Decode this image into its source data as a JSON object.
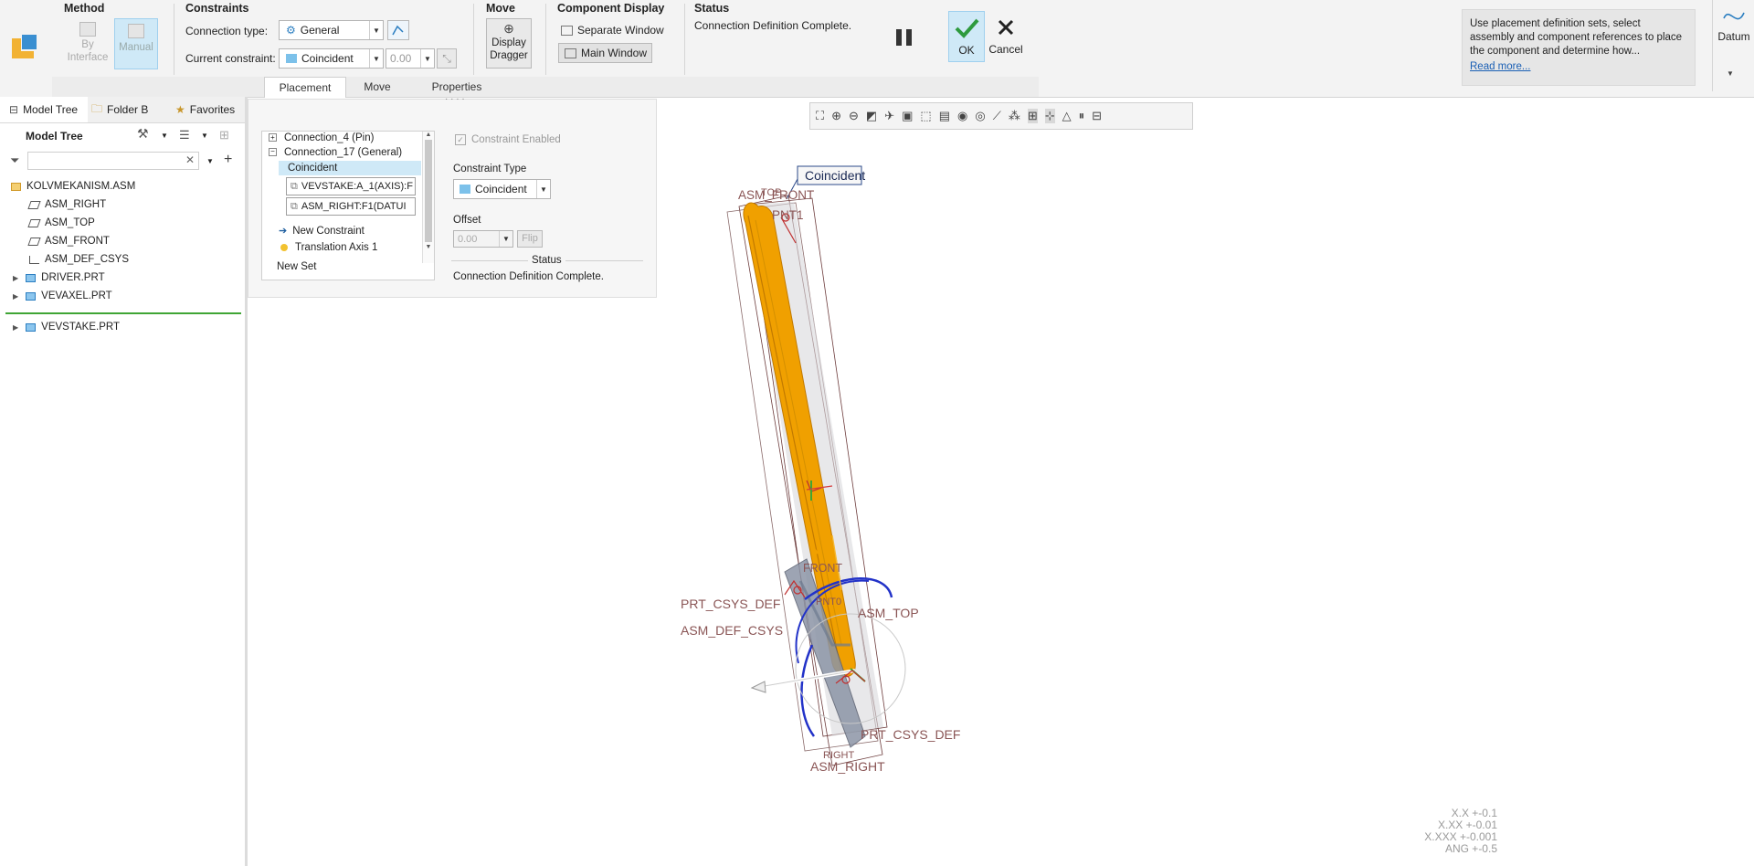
{
  "ribbon": {
    "method": {
      "title": "Method",
      "by_interface": "By\nInterface",
      "manual": "Manual"
    },
    "constraints": {
      "title": "Constraints",
      "connection_type_label": "Connection type:",
      "connection_type_value": "General",
      "current_constraint_label": "Current constraint:",
      "current_constraint_value": "Coincident",
      "offset_value": "0.00"
    },
    "move": {
      "title": "Move",
      "display_dragger": "Display\nDragger"
    },
    "component_display": {
      "title": "Component Display",
      "separate_window": "Separate Window",
      "main_window": "Main Window"
    },
    "status": {
      "title": "Status",
      "text": "Connection Definition Complete."
    },
    "ok_label": "OK",
    "cancel_label": "Cancel",
    "help_text": "Use placement definition sets, select assembly and component references to place the component and determine how...",
    "read_more": "Read more...",
    "datum_label": "Datum",
    "tabs": [
      "Placement",
      "Move",
      "Properties"
    ],
    "accent_color": "#cfe9f7"
  },
  "left_panel": {
    "tabs": [
      "Model Tree",
      "Folder B",
      "Favorites"
    ],
    "tree_title": "Model Tree",
    "filter_placeholder": "",
    "items": [
      {
        "label": "KOLVMEKANISM.ASM",
        "icon": "assembly-icon"
      },
      {
        "label": "ASM_RIGHT",
        "icon": "datum-plane-icon"
      },
      {
        "label": "ASM_TOP",
        "icon": "datum-plane-icon"
      },
      {
        "label": "ASM_FRONT",
        "icon": "datum-plane-icon"
      },
      {
        "label": "ASM_DEF_CSYS",
        "icon": "csys-icon"
      },
      {
        "label": "DRIVER.PRT",
        "icon": "part-icon"
      },
      {
        "label": "VEVAXEL.PRT",
        "icon": "part-icon"
      },
      {
        "label": "VEVSTAKE.PRT",
        "icon": "part-icon"
      }
    ]
  },
  "placement_panel": {
    "sets": {
      "connection_4": "Connection_4 (Pin)",
      "connection_17": "Connection_17 (General)",
      "coincident": "Coincident",
      "ref1": "VEVSTAKE:A_1(AXIS):F",
      "ref2": "ASM_RIGHT:F1(DATUI",
      "new_constraint": "New Constraint",
      "translation_axis": "Translation Axis 1",
      "new_set": "New Set"
    },
    "constraint_enabled": "Constraint Enabled",
    "constraint_type_label": "Constraint Type",
    "constraint_type_value": "Coincident",
    "offset_label": "Offset",
    "offset_value": "0.00",
    "flip_label": "Flip",
    "status_label": "Status",
    "status_text": "Connection Definition Complete."
  },
  "graphics": {
    "callout": "Coincident",
    "labels": {
      "asm_front": "ASM_FRONT",
      "pnt1": "PNT1",
      "top": "TOP",
      "front": "FRONT",
      "prt_csys_def": "PRT_CSYS_DEF",
      "asm_def_csys": "ASM_DEF_CSYS",
      "asm_top": "ASM_TOP",
      "prt_csys_def_2": "PRT_CSYS_DEF",
      "asm_right": "ASM_RIGHT",
      "pnt0": "PNT0",
      "right": "RIGHT"
    },
    "tolerances": [
      "X.X +-0.1",
      "X.XX +-0.01",
      "X.XXX +-0.001",
      "ANG +-0.5"
    ],
    "part_color": "#f0a000"
  }
}
